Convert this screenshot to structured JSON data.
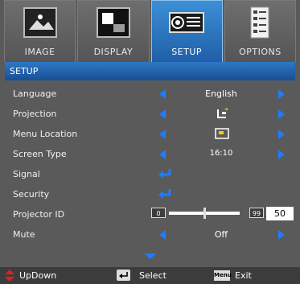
{
  "tabs": [
    {
      "label": "IMAGE",
      "icon": "image-picture-icon",
      "active": false
    },
    {
      "label": "DISPLAY",
      "icon": "display-icon",
      "active": false
    },
    {
      "label": "SETUP",
      "icon": "projector-icon",
      "active": true
    },
    {
      "label": "OPTIONS",
      "icon": "options-checklist-icon",
      "active": false
    }
  ],
  "title": "SETUP",
  "menu": {
    "language": {
      "label": "Language",
      "value": "English"
    },
    "projection": {
      "label": "Projection",
      "icon": "front-projection-icon"
    },
    "menu_location": {
      "label": "Menu Location",
      "icon": "menu-location-center-icon"
    },
    "screen_type": {
      "label": "Screen Type",
      "value": "16:10"
    },
    "signal": {
      "label": "Signal"
    },
    "security": {
      "label": "Security"
    },
    "projector_id": {
      "label": "Projector ID",
      "min": "0",
      "max": "99",
      "value": "50",
      "level": 0.5
    },
    "mute": {
      "label": "Mute",
      "value": "Off"
    }
  },
  "footer": {
    "updown": "UpDown",
    "select": "Select",
    "menu_key": "Menu",
    "exit": "Exit"
  },
  "colors": {
    "accent": "#1e7cff",
    "title_bar": "#2d77c5",
    "background": "#5a5a5a"
  }
}
